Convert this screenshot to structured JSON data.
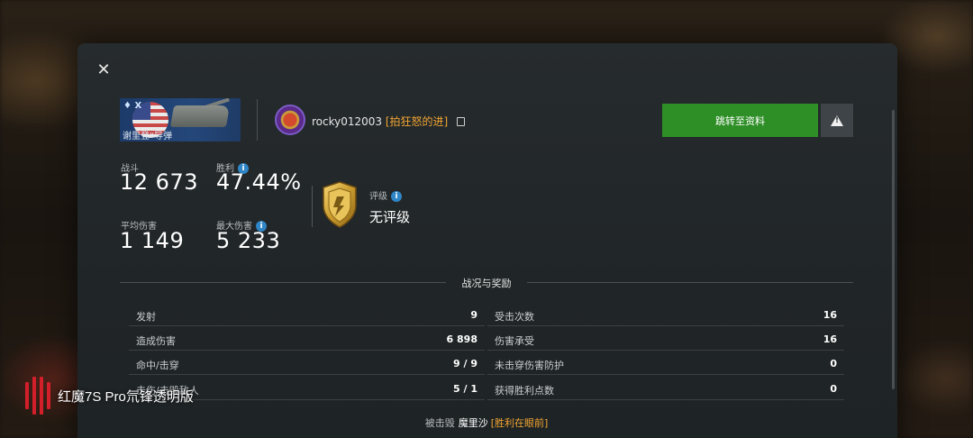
{
  "player": {
    "tank_tier": "X",
    "tank_name": "谢里登“导弹",
    "name": "rocky012003",
    "clan": "[拍狂怒的进]"
  },
  "buttons": {
    "profile": "跳转至资料",
    "close_symbol": "✕"
  },
  "stats": {
    "battles_label": "战斗",
    "battles_value": "12 673",
    "winrate_label": "胜利",
    "winrate_value": "47.44%",
    "avg_damage_label": "平均伤害",
    "avg_damage_value": "1 149",
    "max_damage_label": "最大伤害",
    "max_damage_value": "5 233",
    "rating_label": "评级",
    "rating_value": "无评级"
  },
  "section": {
    "title": "战况与奖励"
  },
  "battle_left": [
    {
      "label": "发射",
      "value": "9"
    },
    {
      "label": "造成伤害",
      "value": "6 898"
    },
    {
      "label": "命中/击穿",
      "value": "9 / 9"
    },
    {
      "label": "击伤/击毁敌人",
      "value": "5 / 1"
    }
  ],
  "battle_right": [
    {
      "label": "受击次数",
      "value": "16"
    },
    {
      "label": "伤害承受",
      "value": "16"
    },
    {
      "label": "未击穿伤害防护",
      "value": "0"
    },
    {
      "label": "获得胜利点数",
      "value": "0"
    }
  ],
  "destroyed_by": {
    "prefix": "被击毁",
    "name": "魔里沙",
    "clan": "[胜利在眼前]"
  },
  "watermark": {
    "text": "红魔7S Pro氘锋透明版"
  },
  "colors": {
    "accent_green": "#2f8f27",
    "clan_orange": "#f2a532",
    "info_blue": "#2f86c7",
    "panel": "#23282a"
  }
}
